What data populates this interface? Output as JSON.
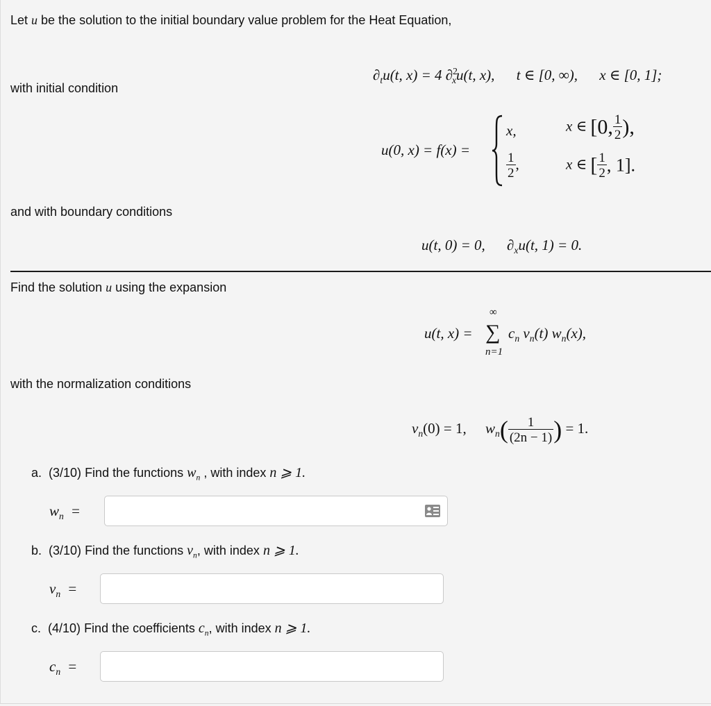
{
  "intro": {
    "prefix": "Let ",
    "var": "u",
    "suffix": " be the solution to the initial boundary value problem for the Heat Equation,"
  },
  "heat_equation": {
    "lhs": "∂",
    "lhs_sub": "t",
    "lhs_rest": "u(t, x) = 4 ∂",
    "rhs_sup": "2",
    "rhs_sub": "x",
    "rhs_rest": "u(t, x),",
    "t_domain": "t ∈ [0, ∞),",
    "x_domain": "x ∈ [0, 1];"
  },
  "initial_condition_label": "with initial condition",
  "initial_condition": {
    "lhs": "u(0, x) = f(x) =",
    "case1_value": "x,",
    "case1_domain_prefix": "x ∈",
    "case1_interval_open": "[0,",
    "case1_interval_num": "1",
    "case1_interval_den": "2",
    "case1_interval_close": "),",
    "case2_value_num": "1",
    "case2_value_den": "2",
    "case2_value_comma": ",",
    "case2_domain_prefix": "x ∈",
    "case2_interval_open": "[",
    "case2_interval_num": "1",
    "case2_interval_den": "2",
    "case2_interval_close": ", 1]."
  },
  "boundary_conditions_label": "and with boundary conditions",
  "boundary_conditions": {
    "bc1": "u(t, 0) = 0,",
    "bc2_partial": "∂",
    "bc2_sub": "x",
    "bc2_rest": "u(t, 1) = 0."
  },
  "expansion_intro": {
    "prefix": "Find the solution ",
    "var": "u",
    "suffix": " using the expansion"
  },
  "expansion": {
    "lhs": "u(t, x) =",
    "sum_symbol": "∑",
    "sum_upper": "∞",
    "sum_lower": "n=1",
    "term": "c",
    "term_sub": "n",
    "v": "v",
    "v_sub": "n",
    "v_arg": "(t)",
    "w": "w",
    "w_sub": "n",
    "w_arg": "(x),"
  },
  "normalization_label": "with the normalization conditions",
  "normalization": {
    "v": "v",
    "v_sub": "n",
    "v_rest": "(0) = 1,",
    "w": "w",
    "w_sub": "n",
    "frac_num": "1",
    "frac_den": "(2n − 1)",
    "rhs": "= 1."
  },
  "questions": [
    {
      "label": "a.",
      "points": "(3/10)",
      "text": " Find the functions ",
      "symbol": "w",
      "symbol_sub": "n",
      "after": " , with index ",
      "index": "n ⩾ 1.",
      "answer_label": "w",
      "answer_label_sub": "n",
      "equals": "=",
      "value": "",
      "has_keyboard_icon": true
    },
    {
      "label": "b.",
      "points": "(3/10)",
      "text": " Find the functions ",
      "symbol": "v",
      "symbol_sub": "n",
      "after": ", with index ",
      "index": "n ⩾ 1.",
      "answer_label": "v",
      "answer_label_sub": "n",
      "equals": "=",
      "value": "",
      "has_keyboard_icon": false
    },
    {
      "label": "c.",
      "points": "(4/10)",
      "text": " Find the coefficients ",
      "symbol": "c",
      "symbol_sub": "n",
      "after": ", with index ",
      "index": "n ⩾ 1.",
      "answer_label": "c",
      "answer_label_sub": "n",
      "equals": "=",
      "value": "",
      "has_keyboard_icon": false
    }
  ],
  "icons": {
    "math_keyboard": "math-keyboard-icon"
  },
  "colors": {
    "background": "#f4f4f4",
    "text": "#111111",
    "input_border": "#c9c9c9",
    "icon": "#8a8a8a"
  }
}
